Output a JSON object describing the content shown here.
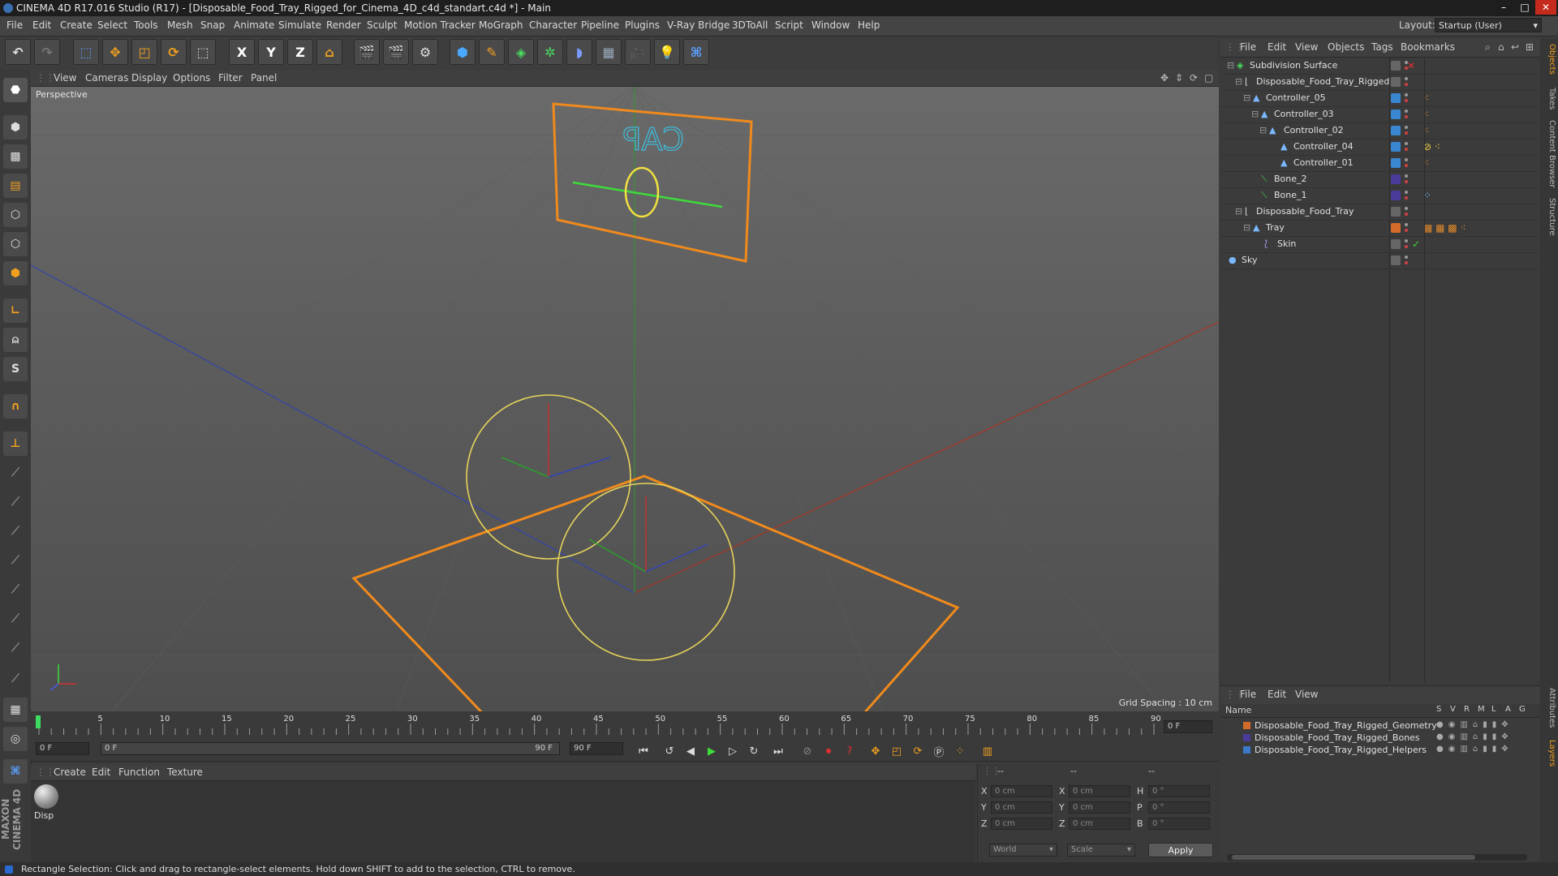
{
  "window": {
    "title": "CINEMA 4D R17.016 Studio (R17) - [Disposable_Food_Tray_Rigged_for_Cinema_4D_c4d_standart.c4d *] - Main",
    "min": "–",
    "max": "□",
    "close": "✕"
  },
  "menubar": {
    "items": [
      "File",
      "Edit",
      "Create",
      "Select",
      "Tools",
      "Mesh",
      "Snap",
      "Animate",
      "Simulate",
      "Render",
      "Sculpt",
      "Motion Tracker",
      "MoGraph",
      "Character",
      "Pipeline",
      "Plugins",
      "V-Ray Bridge",
      "3DToAll",
      "Script",
      "Window",
      "Help"
    ],
    "layout_label": "Layout:",
    "layout_value": "Startup (User)"
  },
  "toolbar": {
    "axis_x": "X",
    "axis_y": "Y",
    "axis_z": "Z"
  },
  "viewport": {
    "menu": [
      "View",
      "Cameras",
      "Display",
      "Options",
      "Filter",
      "Panel"
    ],
    "label": "Perspective",
    "grid_spacing": "Grid Spacing : 10 cm",
    "billboard_text": "CAP"
  },
  "timeline": {
    "ticks": [
      "0",
      "5",
      "10",
      "15",
      "20",
      "25",
      "30",
      "35",
      "40",
      "45",
      "50",
      "55",
      "60",
      "65",
      "70",
      "75",
      "80",
      "85",
      "90"
    ],
    "current_frame": "0 F",
    "start_field": "0 F",
    "range_start": "0 F",
    "range_end": "90 F",
    "end_field": "90 F"
  },
  "materials": {
    "menu": [
      "Create",
      "Edit",
      "Function",
      "Texture"
    ],
    "material_label": "Disp"
  },
  "coordinates": {
    "header_1": "--",
    "header_2": "--",
    "header_3": "--",
    "rows": [
      {
        "l1": "X",
        "v1": "0 cm",
        "l2": "X",
        "v2": "0 cm",
        "l3": "H",
        "v3": "0 °"
      },
      {
        "l1": "Y",
        "v1": "0 cm",
        "l2": "Y",
        "v2": "0 cm",
        "l3": "P",
        "v3": "0 °"
      },
      {
        "l1": "Z",
        "v1": "0 cm",
        "l2": "Z",
        "v2": "0 cm",
        "l3": "B",
        "v3": "0 °"
      }
    ],
    "mode": "World",
    "scale": "Scale",
    "apply": "Apply"
  },
  "object_manager": {
    "menu": [
      "File",
      "Edit",
      "View",
      "Objects",
      "Tags",
      "Bookmarks"
    ],
    "objects": [
      {
        "name": "Subdivision Surface",
        "indent": 0
      },
      {
        "name": "Disposable_Food_Tray_Rigged",
        "indent": 1
      },
      {
        "name": "Controller_05",
        "indent": 2
      },
      {
        "name": "Controller_03",
        "indent": 3
      },
      {
        "name": "Controller_02",
        "indent": 4
      },
      {
        "name": "Controller_04",
        "indent": 5
      },
      {
        "name": "Controller_01",
        "indent": 5
      },
      {
        "name": "Bone_2",
        "indent": 3
      },
      {
        "name": "Bone_1",
        "indent": 3
      },
      {
        "name": "Disposable_Food_Tray",
        "indent": 1
      },
      {
        "name": "Tray",
        "indent": 2
      },
      {
        "name": "Skin",
        "indent": 3
      },
      {
        "name": "Sky",
        "indent": 0
      }
    ]
  },
  "side_tabs": [
    "Objects",
    "Takes",
    "Content Browser",
    "Structure",
    "Attributes",
    "Layers"
  ],
  "layer_manager": {
    "menu": [
      "File",
      "Edit",
      "View"
    ],
    "header_name": "Name",
    "header_flags": [
      "S",
      "V",
      "R",
      "M",
      "L",
      "A",
      "G"
    ],
    "layers": [
      {
        "name": "Disposable_Food_Tray_Rigged_Geometry",
        "color": "#d26b2a"
      },
      {
        "name": "Disposable_Food_Tray_Rigged_Bones",
        "color": "#4a3a9a"
      },
      {
        "name": "Disposable_Food_Tray_Rigged_Helpers",
        "color": "#3a7ac8"
      }
    ]
  },
  "brand": "MAXON CINEMA 4D",
  "status": "Rectangle Selection: Click and drag to rectangle-select elements. Hold down SHIFT to add to the selection, CTRL to remove.",
  "colors": {
    "accent_orange": "#f08a1c",
    "accent_blue": "#3a86d0",
    "selection_yellow": "#e6d35a"
  }
}
